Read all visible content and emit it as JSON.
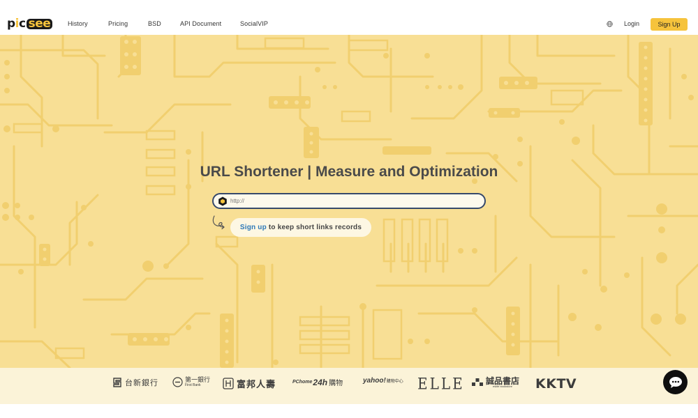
{
  "logo": {
    "p1": "p",
    "p2": "i",
    "p3": "c",
    "see": "see"
  },
  "nav": {
    "items": [
      {
        "label": "History"
      },
      {
        "label": "Pricing"
      },
      {
        "label": "BSD"
      },
      {
        "label": "API Document"
      },
      {
        "label": "SocialVIP"
      }
    ],
    "login": "Login",
    "signup": "Sign Up"
  },
  "hero": {
    "title": "URL Shortener | Measure and Optimization",
    "url_placeholder": "http://",
    "signup_link": "Sign up",
    "signup_rest": " to keep short links records"
  },
  "brands": [
    {
      "label": "台新銀行"
    },
    {
      "label": "第一銀行",
      "sub": "First Bank"
    },
    {
      "label": "富邦人壽"
    },
    {
      "label_a": "PChome",
      "label_b": "24h",
      "label_c": "購物"
    },
    {
      "label": "yahoo!",
      "sub": "購物中心"
    },
    {
      "label": "ELLE"
    },
    {
      "label": "誠品書店",
      "sub": "eslite bookstore"
    },
    {
      "label": "KKTV"
    }
  ],
  "colors": {
    "accent": "#f6c33c",
    "hero_bg": "#f8df95",
    "circuit": "#f1cf6f",
    "link": "#2e79b8",
    "input_border": "#37496b"
  }
}
